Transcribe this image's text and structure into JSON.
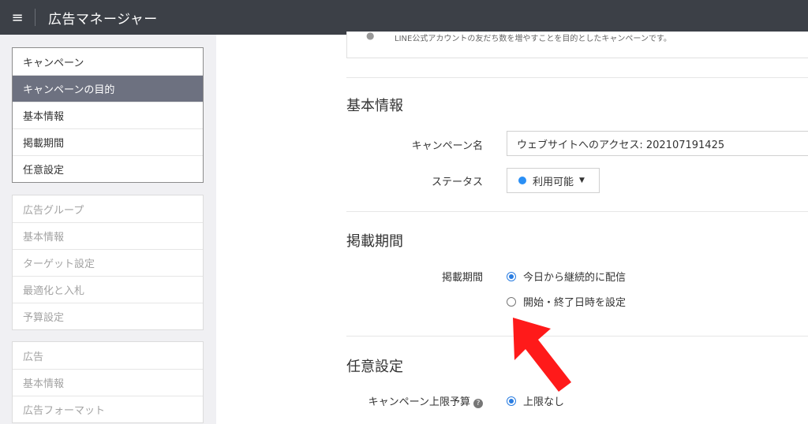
{
  "header": {
    "menu_icon": "≡",
    "app_title": "広告マネージャー"
  },
  "sidebar": {
    "campaign_group": {
      "items": [
        "キャンペーン",
        "キャンペーンの目的",
        "基本情報",
        "掲載期間",
        "任意設定"
      ],
      "selected_index": 1
    },
    "adgroup_group": {
      "items": [
        "広告グループ",
        "基本情報",
        "ターゲット設定",
        "最適化と入札",
        "予算設定"
      ]
    },
    "ad_group": {
      "items": [
        "広告",
        "基本情報",
        "広告フォーマット"
      ]
    }
  },
  "main": {
    "info_text": "LINE公式アカウントの友だち数を増やすことを目的としたキャンペーンです。",
    "basic_info": {
      "title": "基本情報",
      "campaign_name_label": "キャンペーン名",
      "campaign_name_value": "ウェブサイトへのアクセス: 202107191425",
      "status_label": "ステータス",
      "status_value": "利用可能",
      "status_color": "#2a8ff5"
    },
    "schedule": {
      "title": "掲載期間",
      "label": "掲載期間",
      "option_continuous": "今日から継続的に配信",
      "option_set_dates": "開始・終了日時を設定",
      "selected": "continuous"
    },
    "optional": {
      "title": "任意設定",
      "budget_label": "キャンペーン上限予算",
      "budget_option": "上限なし"
    }
  },
  "annotation": {
    "arrow_color": "#ff1a1a"
  }
}
